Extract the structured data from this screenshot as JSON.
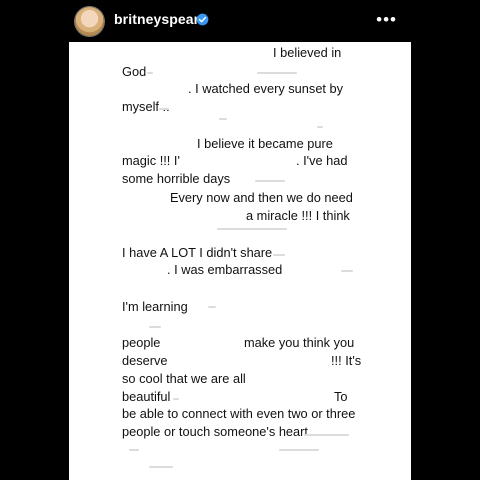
{
  "post": {
    "username": "britneyspears",
    "verified_icon": "verified-badge-icon",
    "more_icon": "more-options-icon",
    "more_label": "•••"
  },
  "note": {
    "lines": [
      "I believed in",
      "God",
      ". I watched every sunset by",
      "myself ..",
      "I believe it became pure",
      "magic !!! I'",
      ". I've had",
      "some horrible days",
      "Every now and then we do need",
      "a miracle !!! I think",
      "I have A LOT I didn't share",
      ". I was embarrassed",
      "I'm learning",
      "people",
      "make you think you",
      "deserve",
      "!!! It's",
      "so cool that we are all",
      "beautiful",
      "To",
      "be able to connect with even two or three",
      "people or touch someone's heart"
    ]
  }
}
